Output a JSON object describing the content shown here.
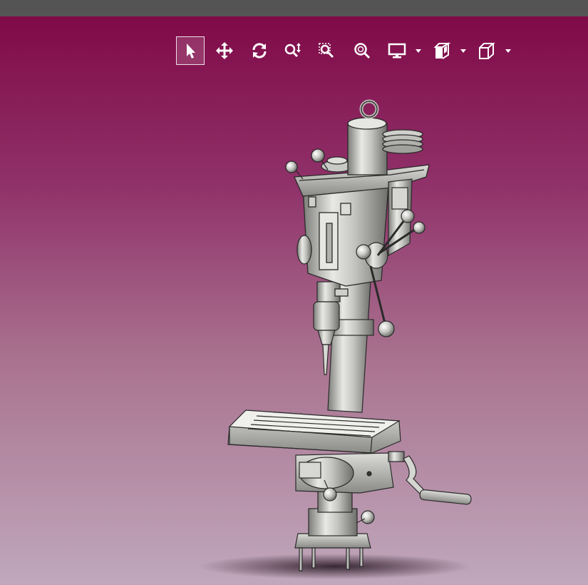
{
  "viewer": {
    "background_top": "#800a48",
    "background_bottom": "#c0a8bc",
    "model_name": "drill press"
  },
  "toolbar": {
    "buttons": [
      {
        "name": "select",
        "icon": "cursor-arrow-icon",
        "active": true
      },
      {
        "name": "pan",
        "icon": "move-arrows-icon",
        "active": false
      },
      {
        "name": "rotate",
        "icon": "rotate-icon",
        "active": false
      },
      {
        "name": "zoom",
        "icon": "zoom-updown-icon",
        "active": false
      },
      {
        "name": "zoom-area",
        "icon": "zoom-box-icon",
        "active": false
      },
      {
        "name": "zoom-fit",
        "icon": "zoom-fit-icon",
        "active": false
      },
      {
        "name": "display-mode",
        "icon": "monitor-icon",
        "active": false,
        "dropdown": true
      },
      {
        "name": "section",
        "icon": "section-cube-icon",
        "active": false,
        "dropdown": true
      },
      {
        "name": "view-orientation",
        "icon": "cube-icon",
        "active": false,
        "dropdown": true
      }
    ]
  }
}
